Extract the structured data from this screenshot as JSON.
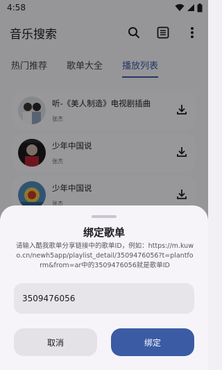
{
  "status_bar": {
    "time": "4:58"
  },
  "app_bar": {
    "title": "音乐搜索"
  },
  "tabs": [
    {
      "label": "热门推荐",
      "active": false
    },
    {
      "label": "歌单大全",
      "active": false
    },
    {
      "label": "播放列表",
      "active": true
    }
  ],
  "songs": [
    {
      "title": "听-《美人制造》电视剧插曲",
      "artist": "张杰"
    },
    {
      "title": "少年中国说",
      "artist": "张杰"
    },
    {
      "title": "少年中国说",
      "artist": "张杰"
    }
  ],
  "dialog": {
    "title": "绑定歌单",
    "description": "请输入酷我歌单分享链接中的歌单ID，例如：https://m.kuwo.cn/newh5app/playlist_detail/3509476056?t=plantform&from=ar中的3509476056就是歌单ID",
    "input_value": "3509476056",
    "cancel_label": "取消",
    "confirm_label": "绑定"
  },
  "colors": {
    "accent": "#3b5ba5",
    "sheet": "#f7f4f9"
  },
  "icons": [
    "wifi-icon",
    "signal-icon",
    "battery-icon",
    "search-icon",
    "list-icon",
    "more-vert-icon",
    "download-icon"
  ]
}
